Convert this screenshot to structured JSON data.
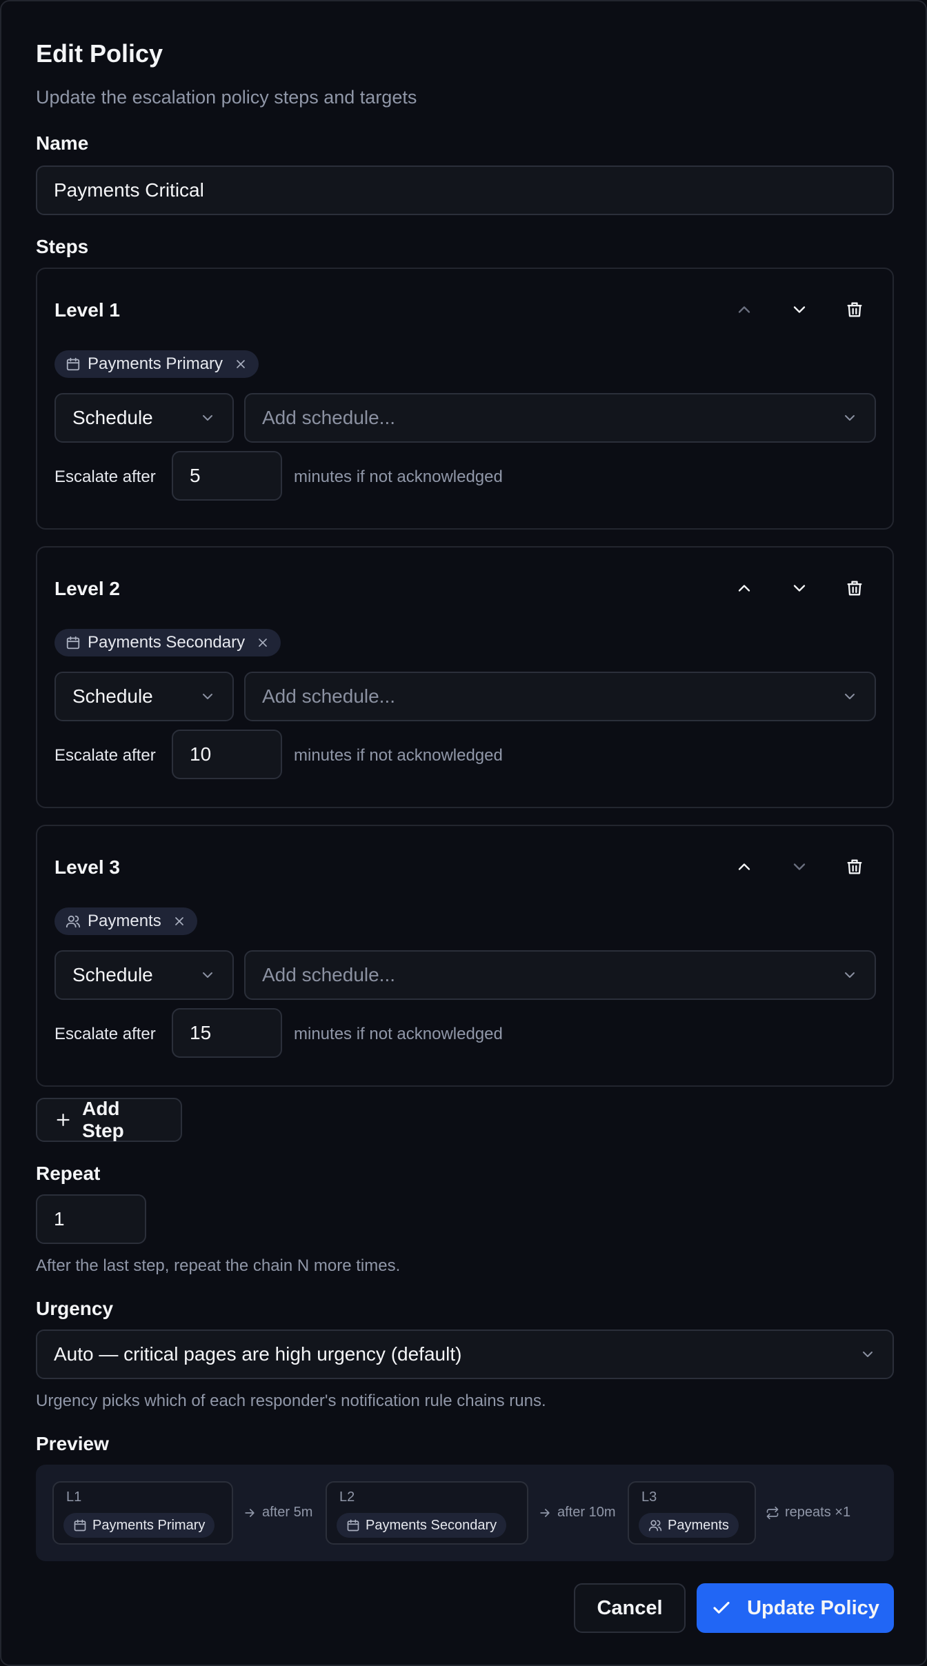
{
  "dialog": {
    "title": "Edit Policy",
    "subtitle": "Update the escalation policy steps and targets"
  },
  "name": {
    "label": "Name",
    "value": "Payments Critical"
  },
  "steps_label": "Steps",
  "steps": [
    {
      "title": "Level 1",
      "chip": "Payments Primary",
      "chip_icon": "calendar-icon",
      "type": "Schedule",
      "target_placeholder": "Add schedule...",
      "escalate_label": "Escalate after",
      "minutes": "5",
      "after_text": "minutes if not acknowledged",
      "up_enabled": false,
      "down_enabled": true
    },
    {
      "title": "Level 2",
      "chip": "Payments Secondary",
      "chip_icon": "calendar-icon",
      "type": "Schedule",
      "target_placeholder": "Add schedule...",
      "escalate_label": "Escalate after",
      "minutes": "10",
      "after_text": "minutes if not acknowledged",
      "up_enabled": true,
      "down_enabled": true
    },
    {
      "title": "Level 3",
      "chip": "Payments",
      "chip_icon": "users-icon",
      "type": "Schedule",
      "target_placeholder": "Add schedule...",
      "escalate_label": "Escalate after",
      "minutes": "15",
      "after_text": "minutes if not acknowledged",
      "up_enabled": true,
      "down_enabled": false
    }
  ],
  "add_step_label": "Add Step",
  "repeat": {
    "label": "Repeat",
    "value": "1",
    "help": "After the last step, repeat the chain N more times."
  },
  "urgency": {
    "label": "Urgency",
    "value": "Auto — critical pages are high urgency (default)",
    "help": "Urgency picks which of each responder's notification rule chains runs."
  },
  "preview": {
    "label": "Preview",
    "items": [
      {
        "level": "L1",
        "target": "Payments Primary",
        "icon": "calendar-icon",
        "after": "after 5m"
      },
      {
        "level": "L2",
        "target": "Payments Secondary",
        "icon": "calendar-icon",
        "after": "after 10m"
      },
      {
        "level": "L3",
        "target": "Payments",
        "icon": "users-icon",
        "after": ""
      }
    ],
    "repeats": "repeats ×1"
  },
  "footer": {
    "cancel": "Cancel",
    "update": "Update Policy"
  },
  "colors": {
    "accent": "#2166f5",
    "background": "#0b0d14",
    "chip_bg": "#1f2436"
  }
}
